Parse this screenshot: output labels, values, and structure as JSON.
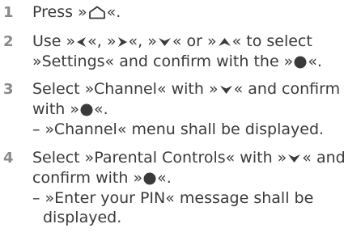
{
  "steps": [
    {
      "number": "1",
      "line1": {
        "before": "Press »",
        "after": "«."
      }
    },
    {
      "number": "2",
      "line1": {
        "a": "Use »",
        "b": "«, »",
        "c": "«, »",
        "d": "« or »",
        "e": "« to select"
      },
      "line2": {
        "before": "»Settings« and confirm with the »",
        "after": "«."
      }
    },
    {
      "number": "3",
      "line1": {
        "before": "Select »Channel« with »",
        "after": "« and confirm"
      },
      "line2": {
        "before": "with »",
        "after": "«."
      },
      "note": "– »Channel« menu shall be displayed."
    },
    {
      "number": "4",
      "line1": {
        "before": "Select »Parental Controls« with »",
        "after": "« and"
      },
      "line2": {
        "before": "confirm with »",
        "after": "«."
      },
      "note_line1": "– »Enter your PIN«  message shall be",
      "note_line2": "displayed."
    }
  ],
  "icons": {
    "home": "home-icon",
    "left": "arrow-left-icon",
    "right": "arrow-right-icon",
    "down": "arrow-down-icon",
    "up": "arrow-up-icon",
    "ok": "ok-button-icon"
  },
  "colors": {
    "text": "#3a3a3a",
    "step_number": "#8a8a8a",
    "icon": "#3a3a3a"
  }
}
